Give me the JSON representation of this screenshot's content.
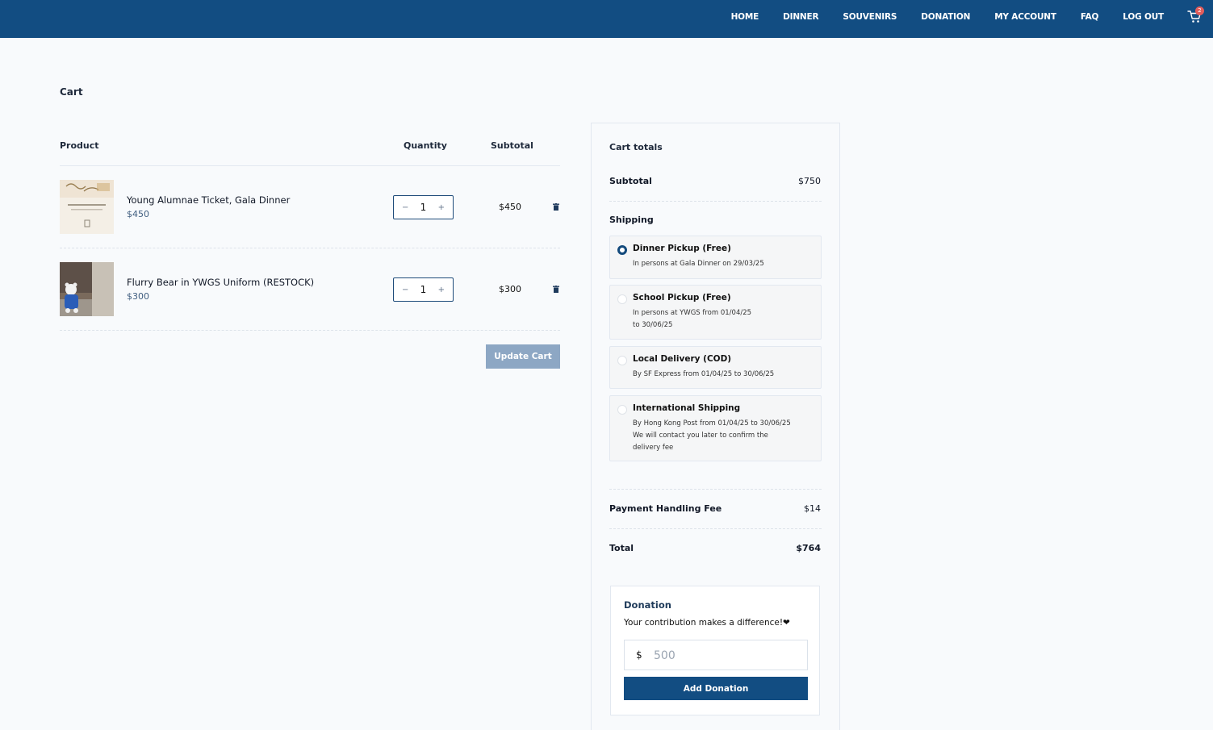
{
  "nav": {
    "items": [
      "HOME",
      "DINNER",
      "SOUVENIRS",
      "DONATION",
      "MY ACCOUNT",
      "FAQ",
      "LOG OUT"
    ],
    "cart_count": "2"
  },
  "page": {
    "title": "Cart"
  },
  "table": {
    "col_product": "Product",
    "col_quantity": "Quantity",
    "col_subtotal": "Subtotal"
  },
  "items": [
    {
      "name": "Young Alumnae Ticket, Gala Dinner",
      "price": "$450",
      "qty": "1",
      "subtotal": "$450",
      "minus": "−",
      "plus": "+"
    },
    {
      "name": "Flurry Bear in YWGS Uniform (RESTOCK)",
      "price": "$300",
      "qty": "1",
      "subtotal": "$300",
      "minus": "−",
      "plus": "+"
    }
  ],
  "update_cart": "Update Cart",
  "totals": {
    "title": "Cart totals",
    "subtotal_label": "Subtotal",
    "subtotal_value": "$750",
    "shipping_label": "Shipping",
    "shipping_options": [
      {
        "title": "Dinner Pickup (Free)",
        "desc": "In persons at Gala Dinner on 29/03/25",
        "selected": true
      },
      {
        "title": "School Pickup (Free)",
        "desc": "In persons at YWGS from 01/04/25\nto 30/06/25",
        "selected": false
      },
      {
        "title": "Local Delivery (COD)",
        "desc": "By SF Express from 01/04/25 to 30/06/25",
        "selected": false
      },
      {
        "title": "International Shipping",
        "desc": "By Hong Kong Post from 01/04/25 to 30/06/25\nWe will contact you later to confirm the\ndelivery fee",
        "selected": false
      }
    ],
    "fee_label": "Payment Handling Fee",
    "fee_value": "$14",
    "total_label": "Total",
    "total_value": "$764"
  },
  "donation": {
    "title": "Donation",
    "subtitle": "Your contribution makes a difference!❤",
    "currency": "$",
    "placeholder": "500",
    "button": "Add Donation"
  },
  "colors": {
    "brand": "#124d82",
    "update_button": "#8da7c4",
    "badge": "#e35d5b"
  }
}
